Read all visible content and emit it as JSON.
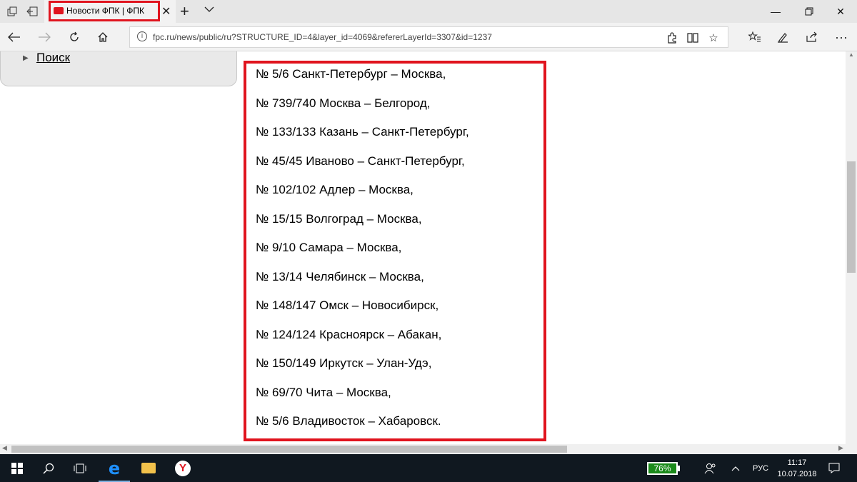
{
  "browser": {
    "tab_title": "Новости ФПК | ФПК",
    "url": "fpc.ru/news/public/ru?STRUCTURE_ID=4&layer_id=4069&refererLayerId=3307&id=1237"
  },
  "sidebar": {
    "link_label": "Поиск"
  },
  "routes": [
    "№ 5/6 Санкт-Петербург – Москва,",
    "№ 739/740 Москва – Белгород,",
    "№ 133/133 Казань – Санкт-Петербург,",
    "№ 45/45 Иваново – Санкт-Петербург,",
    "№ 102/102 Адлер – Москва,",
    "№ 15/15 Волгоград – Москва,",
    "№ 9/10 Самара – Москва,",
    "№ 13/14 Челябинск – Москва,",
    "№ 148/147 Омск – Новосибирск,",
    "№ 124/124 Красноярск – Абакан,",
    "№ 150/149 Иркутск – Улан-Удэ,",
    "№ 69/70 Чита – Москва,",
    "№ 5/6 Владивосток – Хабаровск."
  ],
  "taskbar": {
    "battery": "76%",
    "language": "РУС",
    "time": "11:17",
    "date": "10.07.2018"
  },
  "colors": {
    "highlight": "#e0141e",
    "taskbar": "#101820"
  }
}
